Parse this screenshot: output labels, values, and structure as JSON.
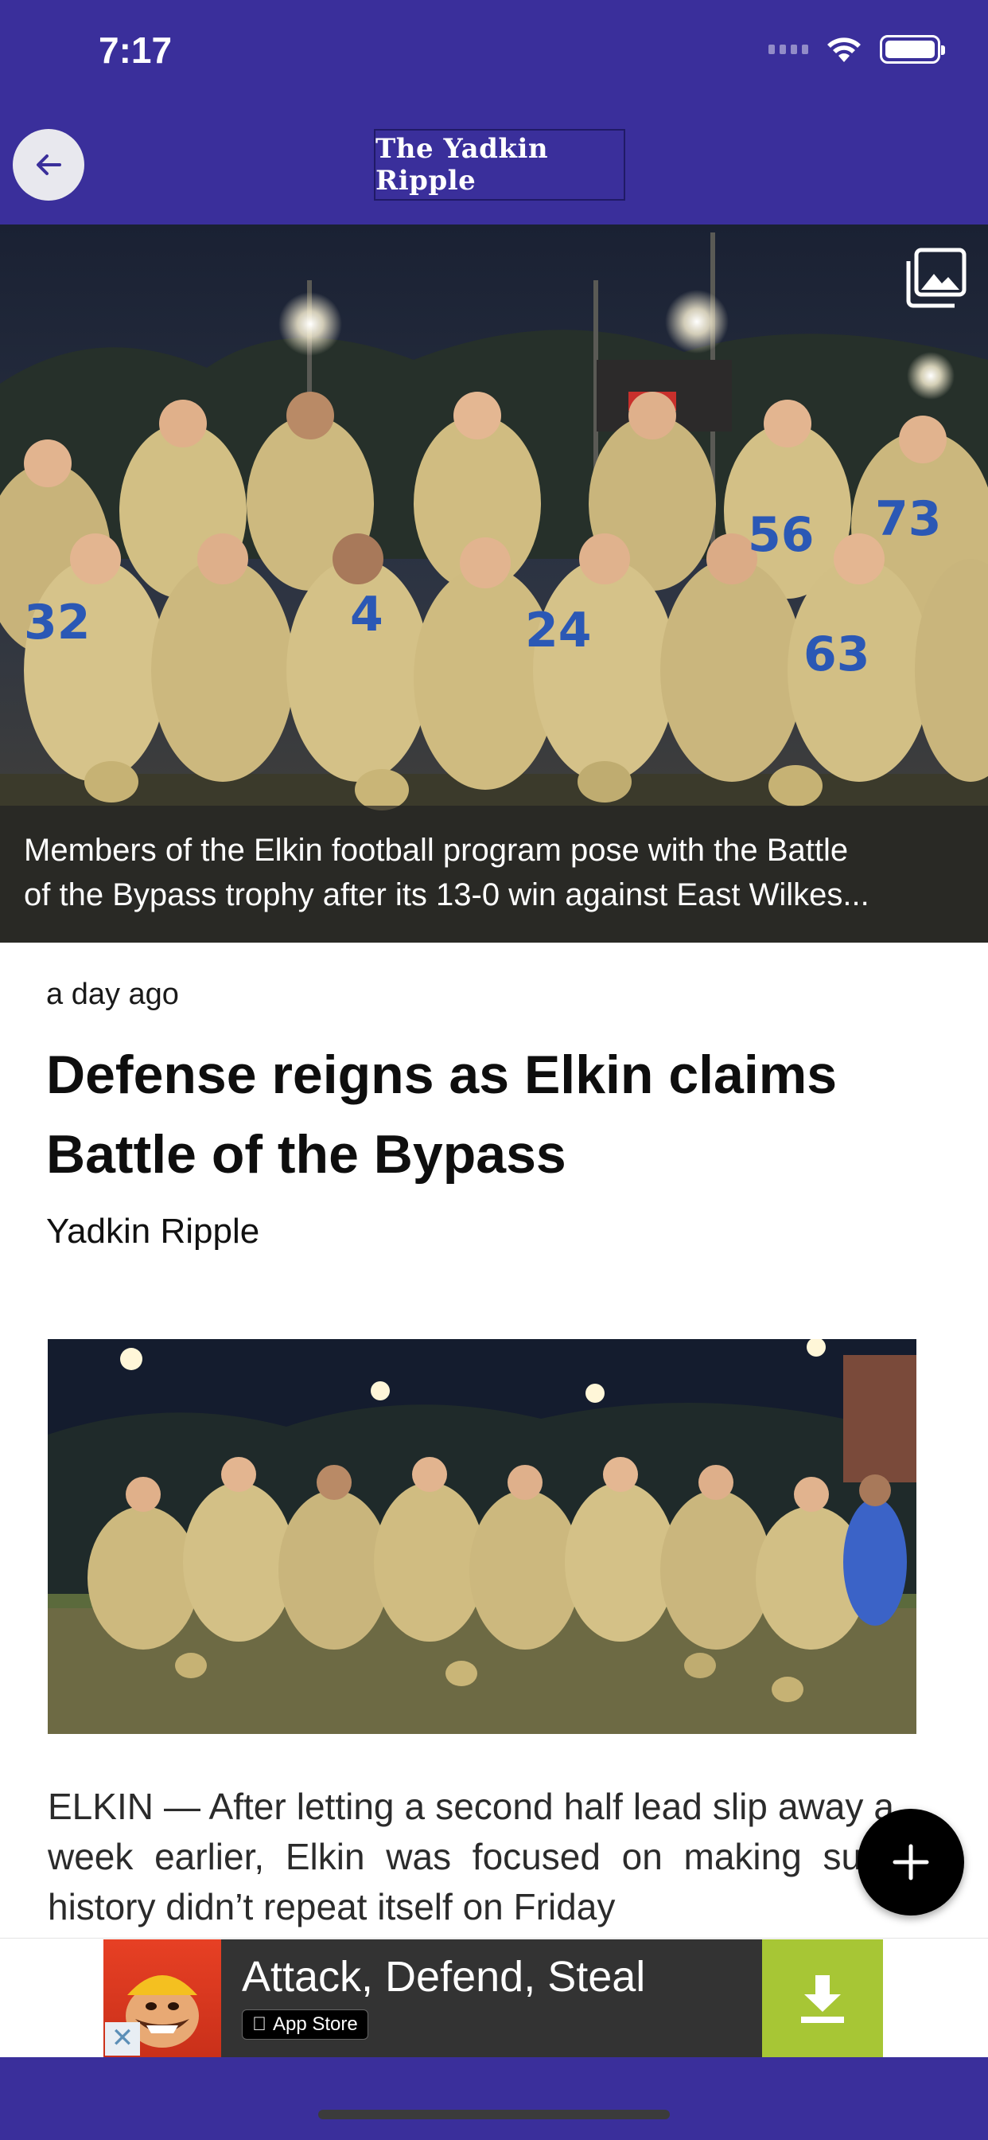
{
  "status_bar": {
    "time": "7:17"
  },
  "header": {
    "publication": "The Yadkin Ripple",
    "back_icon": "arrow-left-icon",
    "bg_color": "#3a2f9b"
  },
  "hero": {
    "gallery_icon": "image-gallery-icon",
    "caption_line1": "Members of the Elkin football program pose with the Battle",
    "caption_line2": "of the Bypass trophy after its 13-0 win against East Wilkes..."
  },
  "article": {
    "time_ago": "a day ago",
    "headline": "Defense reigns as Elkin claims Battle of the Bypass",
    "byline": "Yadkin Ripple",
    "body_preview": "ELKIN — After letting a second half lead slip away a week earlier, Elkin was focused on making sure history didn’t repeat itself on Friday"
  },
  "fab": {
    "icon": "plus-icon"
  },
  "ad": {
    "title": "Attack, Defend, Steal",
    "store_label": "App Store",
    "download_icon": "download-arrow-icon",
    "close_glyph": "✕",
    "accent_color": "#a7c635"
  }
}
